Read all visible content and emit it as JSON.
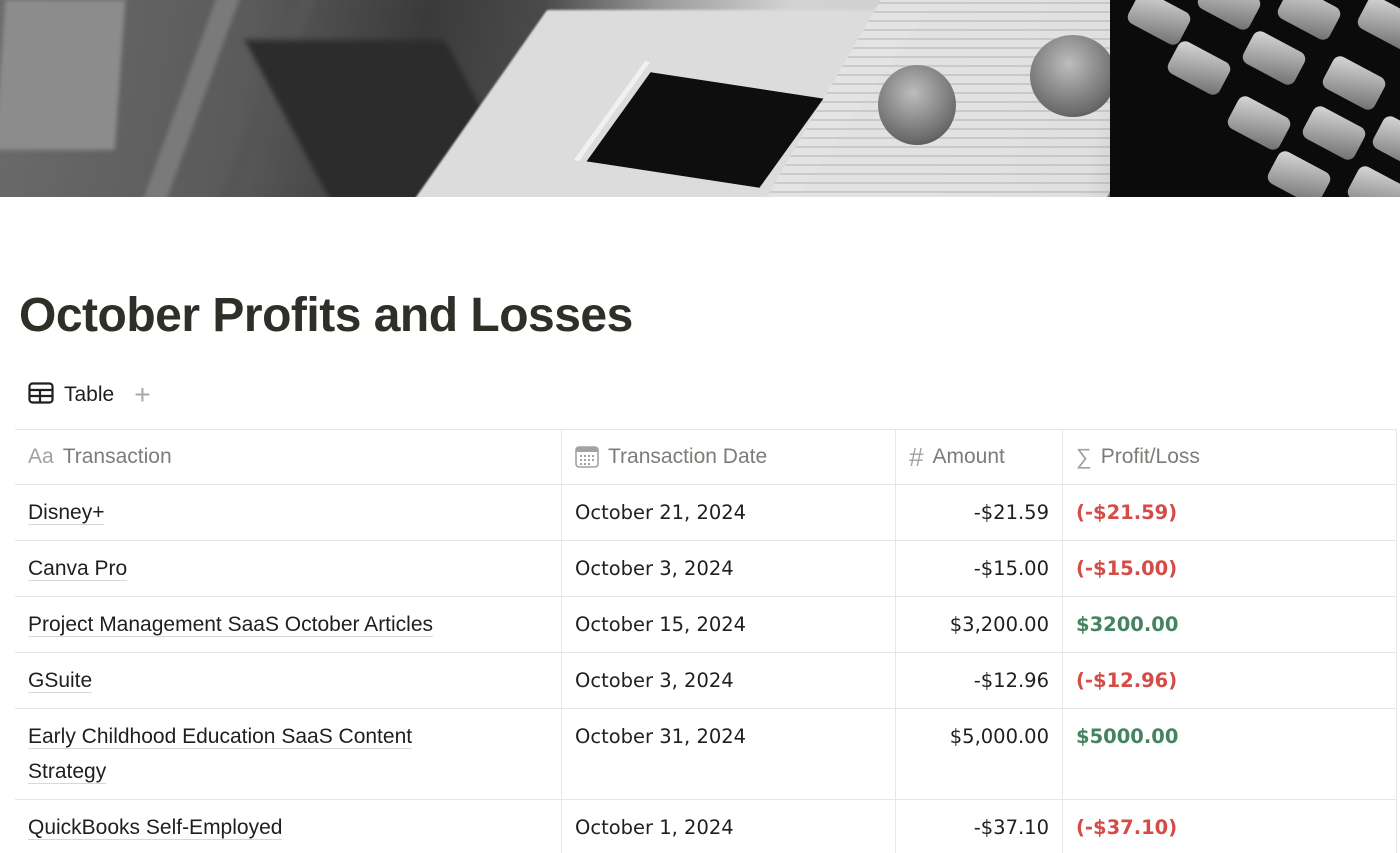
{
  "page": {
    "title": "October Profits and Losses",
    "cover_alt": "grayscale photo of a vintage cash register"
  },
  "views": {
    "tabs": [
      {
        "label": "Table",
        "icon": "table-icon",
        "active": true
      }
    ],
    "add_view_label": "+"
  },
  "table": {
    "columns": [
      {
        "key": "transaction",
        "label": "Transaction",
        "icon": "title-property-icon",
        "icon_glyph": "Aa"
      },
      {
        "key": "date",
        "label": "Transaction Date",
        "icon": "calendar-icon"
      },
      {
        "key": "amount",
        "label": "Amount",
        "icon": "number-icon",
        "icon_glyph": "#"
      },
      {
        "key": "profit_loss",
        "label": "Profit/Loss",
        "icon": "formula-icon",
        "icon_glyph": "∑"
      }
    ],
    "rows": [
      {
        "transaction": "Disney+",
        "date": "October 21, 2024",
        "amount": "-$21.59",
        "profit_loss": "(-$21.59)",
        "status": "loss"
      },
      {
        "transaction": "Canva Pro",
        "date": "October 3, 2024",
        "amount": "-$15.00",
        "profit_loss": "(-$15.00)",
        "status": "loss"
      },
      {
        "transaction": "Project Management SaaS October Articles",
        "date": "October 15, 2024",
        "amount": "$3,200.00",
        "profit_loss": "$3200.00",
        "status": "profit"
      },
      {
        "transaction": "GSuite",
        "date": "October 3, 2024",
        "amount": "-$12.96",
        "profit_loss": "(-$12.96)",
        "status": "loss"
      },
      {
        "transaction": "Early Childhood Education SaaS Content Strategy",
        "date": "October 31, 2024",
        "amount": "$5,000.00",
        "profit_loss": "$5000.00",
        "status": "profit"
      },
      {
        "transaction": "QuickBooks Self-Employed",
        "date": "October 1, 2024",
        "amount": "-$37.10",
        "profit_loss": "(-$37.10)",
        "status": "loss"
      }
    ]
  },
  "colors": {
    "loss": "#d44c47",
    "profit": "#448361",
    "title": "#2f2e28",
    "header_text": "#7d7c78",
    "border": "#e6e6e4"
  }
}
